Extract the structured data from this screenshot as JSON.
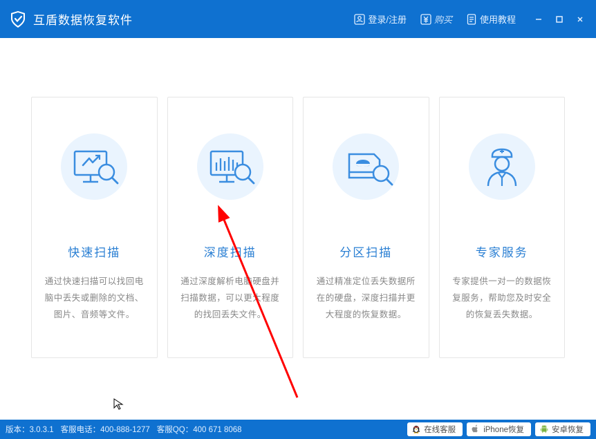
{
  "header": {
    "title": "互盾数据恢复软件",
    "login_label": "登录/注册",
    "buy_label": "购买",
    "tutorial_label": "使用教程"
  },
  "cards": [
    {
      "title": "快速扫描",
      "desc": "通过快速扫描可以找回电脑中丢失或删除的文档、图片、音频等文件。"
    },
    {
      "title": "深度扫描",
      "desc": "通过深度解析电脑硬盘并扫描数据，可以更大程度的找回丢失文件。"
    },
    {
      "title": "分区扫描",
      "desc": "通过精准定位丢失数据所在的硬盘，深度扫描并更大程度的恢复数据。"
    },
    {
      "title": "专家服务",
      "desc": "专家提供一对一的数据恢复服务，帮助您及时安全的恢复丢失数据。"
    }
  ],
  "footer": {
    "version_label": "版本：",
    "version": "3.0.3.1",
    "phone_label": "客服电话：",
    "phone": "400-888-1277",
    "qq_label": "客服QQ：",
    "qq": "400 671 8068",
    "online_service": "在线客服",
    "iphone_recovery": "iPhone恢复",
    "android_recovery": "安卓恢复"
  }
}
